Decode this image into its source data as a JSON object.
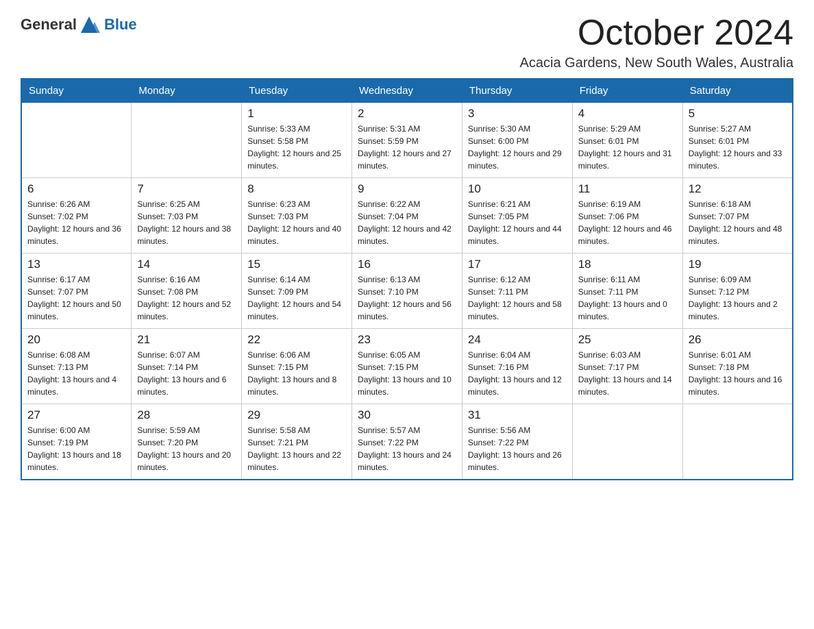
{
  "header": {
    "logo_general": "General",
    "logo_blue": "Blue",
    "month_title": "October 2024",
    "location": "Acacia Gardens, New South Wales, Australia"
  },
  "days_of_week": [
    "Sunday",
    "Monday",
    "Tuesday",
    "Wednesday",
    "Thursday",
    "Friday",
    "Saturday"
  ],
  "weeks": [
    [
      {
        "day": "",
        "sunrise": "",
        "sunset": "",
        "daylight": ""
      },
      {
        "day": "",
        "sunrise": "",
        "sunset": "",
        "daylight": ""
      },
      {
        "day": "1",
        "sunrise": "Sunrise: 5:33 AM",
        "sunset": "Sunset: 5:58 PM",
        "daylight": "Daylight: 12 hours and 25 minutes."
      },
      {
        "day": "2",
        "sunrise": "Sunrise: 5:31 AM",
        "sunset": "Sunset: 5:59 PM",
        "daylight": "Daylight: 12 hours and 27 minutes."
      },
      {
        "day": "3",
        "sunrise": "Sunrise: 5:30 AM",
        "sunset": "Sunset: 6:00 PM",
        "daylight": "Daylight: 12 hours and 29 minutes."
      },
      {
        "day": "4",
        "sunrise": "Sunrise: 5:29 AM",
        "sunset": "Sunset: 6:01 PM",
        "daylight": "Daylight: 12 hours and 31 minutes."
      },
      {
        "day": "5",
        "sunrise": "Sunrise: 5:27 AM",
        "sunset": "Sunset: 6:01 PM",
        "daylight": "Daylight: 12 hours and 33 minutes."
      }
    ],
    [
      {
        "day": "6",
        "sunrise": "Sunrise: 6:26 AM",
        "sunset": "Sunset: 7:02 PM",
        "daylight": "Daylight: 12 hours and 36 minutes."
      },
      {
        "day": "7",
        "sunrise": "Sunrise: 6:25 AM",
        "sunset": "Sunset: 7:03 PM",
        "daylight": "Daylight: 12 hours and 38 minutes."
      },
      {
        "day": "8",
        "sunrise": "Sunrise: 6:23 AM",
        "sunset": "Sunset: 7:03 PM",
        "daylight": "Daylight: 12 hours and 40 minutes."
      },
      {
        "day": "9",
        "sunrise": "Sunrise: 6:22 AM",
        "sunset": "Sunset: 7:04 PM",
        "daylight": "Daylight: 12 hours and 42 minutes."
      },
      {
        "day": "10",
        "sunrise": "Sunrise: 6:21 AM",
        "sunset": "Sunset: 7:05 PM",
        "daylight": "Daylight: 12 hours and 44 minutes."
      },
      {
        "day": "11",
        "sunrise": "Sunrise: 6:19 AM",
        "sunset": "Sunset: 7:06 PM",
        "daylight": "Daylight: 12 hours and 46 minutes."
      },
      {
        "day": "12",
        "sunrise": "Sunrise: 6:18 AM",
        "sunset": "Sunset: 7:07 PM",
        "daylight": "Daylight: 12 hours and 48 minutes."
      }
    ],
    [
      {
        "day": "13",
        "sunrise": "Sunrise: 6:17 AM",
        "sunset": "Sunset: 7:07 PM",
        "daylight": "Daylight: 12 hours and 50 minutes."
      },
      {
        "day": "14",
        "sunrise": "Sunrise: 6:16 AM",
        "sunset": "Sunset: 7:08 PM",
        "daylight": "Daylight: 12 hours and 52 minutes."
      },
      {
        "day": "15",
        "sunrise": "Sunrise: 6:14 AM",
        "sunset": "Sunset: 7:09 PM",
        "daylight": "Daylight: 12 hours and 54 minutes."
      },
      {
        "day": "16",
        "sunrise": "Sunrise: 6:13 AM",
        "sunset": "Sunset: 7:10 PM",
        "daylight": "Daylight: 12 hours and 56 minutes."
      },
      {
        "day": "17",
        "sunrise": "Sunrise: 6:12 AM",
        "sunset": "Sunset: 7:11 PM",
        "daylight": "Daylight: 12 hours and 58 minutes."
      },
      {
        "day": "18",
        "sunrise": "Sunrise: 6:11 AM",
        "sunset": "Sunset: 7:11 PM",
        "daylight": "Daylight: 13 hours and 0 minutes."
      },
      {
        "day": "19",
        "sunrise": "Sunrise: 6:09 AM",
        "sunset": "Sunset: 7:12 PM",
        "daylight": "Daylight: 13 hours and 2 minutes."
      }
    ],
    [
      {
        "day": "20",
        "sunrise": "Sunrise: 6:08 AM",
        "sunset": "Sunset: 7:13 PM",
        "daylight": "Daylight: 13 hours and 4 minutes."
      },
      {
        "day": "21",
        "sunrise": "Sunrise: 6:07 AM",
        "sunset": "Sunset: 7:14 PM",
        "daylight": "Daylight: 13 hours and 6 minutes."
      },
      {
        "day": "22",
        "sunrise": "Sunrise: 6:06 AM",
        "sunset": "Sunset: 7:15 PM",
        "daylight": "Daylight: 13 hours and 8 minutes."
      },
      {
        "day": "23",
        "sunrise": "Sunrise: 6:05 AM",
        "sunset": "Sunset: 7:15 PM",
        "daylight": "Daylight: 13 hours and 10 minutes."
      },
      {
        "day": "24",
        "sunrise": "Sunrise: 6:04 AM",
        "sunset": "Sunset: 7:16 PM",
        "daylight": "Daylight: 13 hours and 12 minutes."
      },
      {
        "day": "25",
        "sunrise": "Sunrise: 6:03 AM",
        "sunset": "Sunset: 7:17 PM",
        "daylight": "Daylight: 13 hours and 14 minutes."
      },
      {
        "day": "26",
        "sunrise": "Sunrise: 6:01 AM",
        "sunset": "Sunset: 7:18 PM",
        "daylight": "Daylight: 13 hours and 16 minutes."
      }
    ],
    [
      {
        "day": "27",
        "sunrise": "Sunrise: 6:00 AM",
        "sunset": "Sunset: 7:19 PM",
        "daylight": "Daylight: 13 hours and 18 minutes."
      },
      {
        "day": "28",
        "sunrise": "Sunrise: 5:59 AM",
        "sunset": "Sunset: 7:20 PM",
        "daylight": "Daylight: 13 hours and 20 minutes."
      },
      {
        "day": "29",
        "sunrise": "Sunrise: 5:58 AM",
        "sunset": "Sunset: 7:21 PM",
        "daylight": "Daylight: 13 hours and 22 minutes."
      },
      {
        "day": "30",
        "sunrise": "Sunrise: 5:57 AM",
        "sunset": "Sunset: 7:22 PM",
        "daylight": "Daylight: 13 hours and 24 minutes."
      },
      {
        "day": "31",
        "sunrise": "Sunrise: 5:56 AM",
        "sunset": "Sunset: 7:22 PM",
        "daylight": "Daylight: 13 hours and 26 minutes."
      },
      {
        "day": "",
        "sunrise": "",
        "sunset": "",
        "daylight": ""
      },
      {
        "day": "",
        "sunrise": "",
        "sunset": "",
        "daylight": ""
      }
    ]
  ]
}
